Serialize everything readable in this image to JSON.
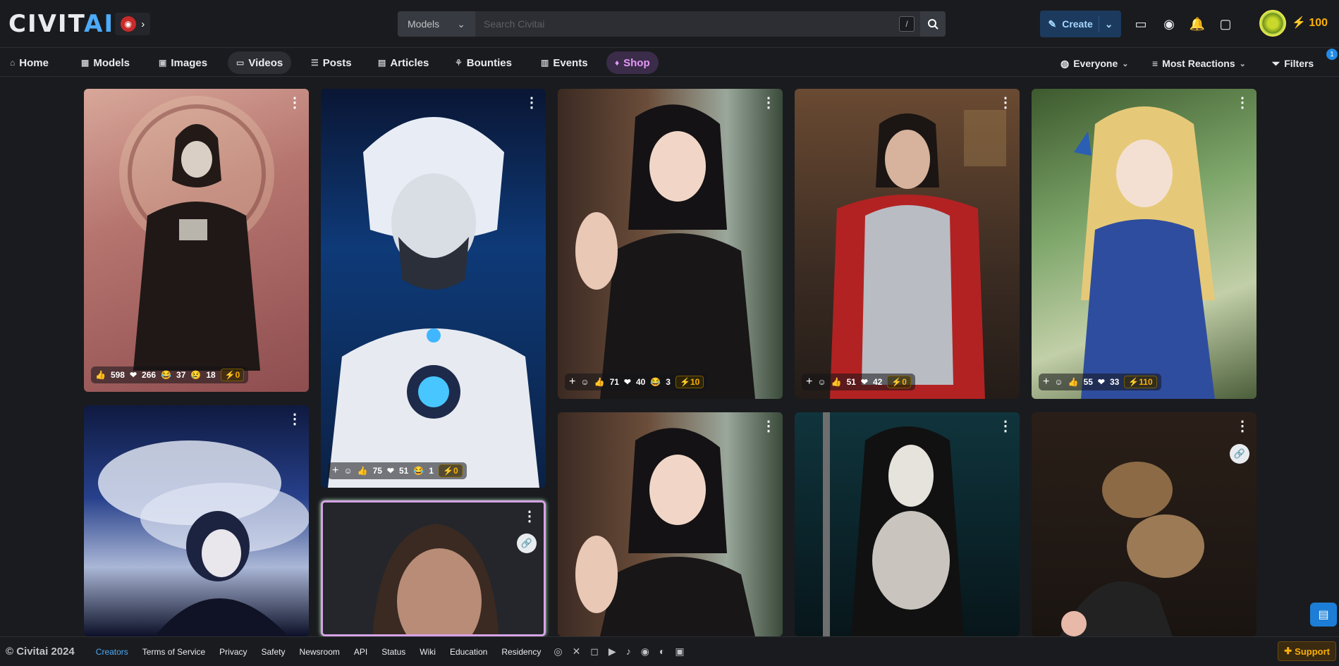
{
  "header": {
    "logo_a": "CIVIT",
    "logo_b": "AI",
    "search_type": "Models",
    "search_placeholder": "Search Civitai",
    "search_shortcut": "/",
    "create_label": "Create",
    "buzz_count": "100"
  },
  "nav": {
    "items": [
      {
        "label": "Home",
        "icon": "home-icon"
      },
      {
        "label": "Models",
        "icon": "grid-icon"
      },
      {
        "label": "Images",
        "icon": "photo-icon"
      },
      {
        "label": "Videos",
        "icon": "video-icon"
      },
      {
        "label": "Posts",
        "icon": "posts-icon"
      },
      {
        "label": "Articles",
        "icon": "article-icon"
      },
      {
        "label": "Bounties",
        "icon": "bounty-icon"
      },
      {
        "label": "Events",
        "icon": "calendar-icon"
      },
      {
        "label": "Shop",
        "icon": "shop-icon"
      }
    ],
    "audience": "Everyone",
    "sort": "Most Reactions",
    "filters": "Filters",
    "filter_count": "1"
  },
  "cards": [
    {
      "like": "598",
      "heart": "266",
      "laugh": "37",
      "cry": "18",
      "buzz": "0"
    },
    {
      "like": "75",
      "heart": "51",
      "laugh": "1",
      "buzz": "0"
    },
    {
      "like": "71",
      "heart": "40",
      "laugh": "3",
      "buzz": "10"
    },
    {
      "like": "51",
      "heart": "42",
      "buzz": "0"
    },
    {
      "like": "55",
      "heart": "33",
      "buzz": "110"
    }
  ],
  "footer": {
    "copyright": "© Civitai 2024",
    "links": [
      "Creators",
      "Terms of Service",
      "Privacy",
      "Safety",
      "Newsroom",
      "API",
      "Status",
      "Wiki",
      "Education",
      "Residency"
    ],
    "support": "Support"
  },
  "colors": {
    "accent": "#4dabf7",
    "buzz": "#fab005",
    "shop": "#e599f7",
    "bg": "#1a1b1e"
  }
}
